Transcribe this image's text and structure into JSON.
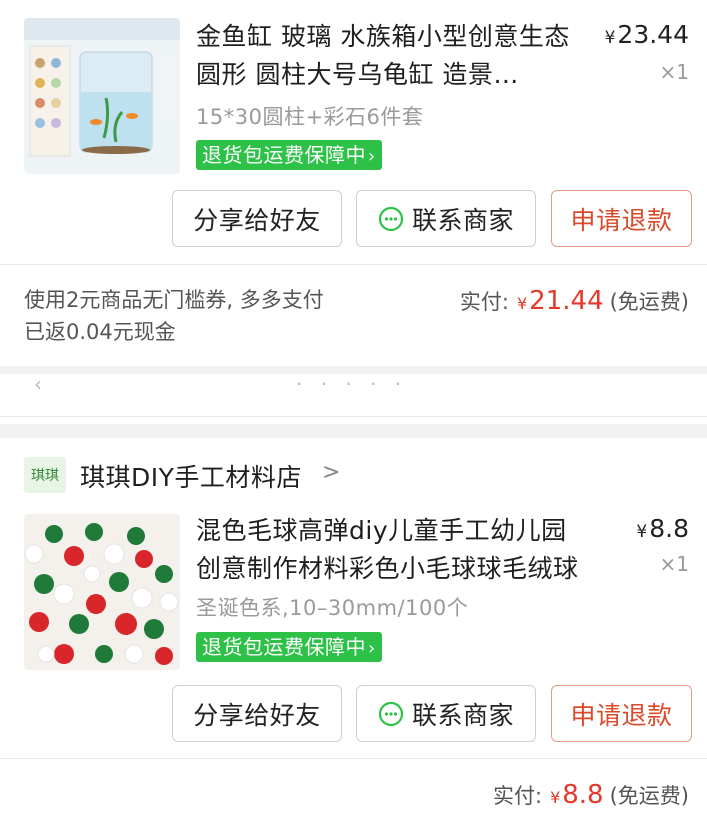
{
  "orders": [
    {
      "product": {
        "title": "金鱼缸 玻璃 水族箱小型创意生态圆形 圆柱大号乌龟缸 造景…",
        "price_symbol": "¥",
        "price": "23.44",
        "qty": "×1",
        "spec": "15*30圆柱+彩石6件套",
        "guarantee": "退货包运费保障中",
        "thumb_icon": "fish-tank-image"
      },
      "buttons": {
        "share": "分享给好友",
        "contact": "联系商家",
        "refund": "申请退款"
      },
      "coupon_note": "使用2元商品无门槛券, 多多支付已返0.04元现金",
      "paid": {
        "label": "实付:",
        "symbol": "¥",
        "amount": "21.44",
        "shipping": "(免运费)"
      }
    },
    {
      "store": {
        "logo_text": "琪琪",
        "name": "琪琪DIY手工材料店",
        "chevron": ">"
      },
      "product": {
        "title": "混色毛球高弹diy儿童手工幼儿园创意制作材料彩色小毛球球毛绒球",
        "price_symbol": "¥",
        "price": "8.8",
        "qty": "×1",
        "spec": "圣诞色系,10–30mm/100个",
        "guarantee": "退货包运费保障中",
        "thumb_icon": "pompom-balls-image"
      },
      "buttons": {
        "share": "分享给好友",
        "contact": "联系商家",
        "refund": "申请退款"
      },
      "paid": {
        "label": "实付:",
        "symbol": "¥",
        "amount": "8.8",
        "shipping": "(免运费)"
      }
    }
  ],
  "colors": {
    "accent_green": "#2ec148",
    "price_red": "#e4392b",
    "refund_red": "#d94b2b"
  }
}
